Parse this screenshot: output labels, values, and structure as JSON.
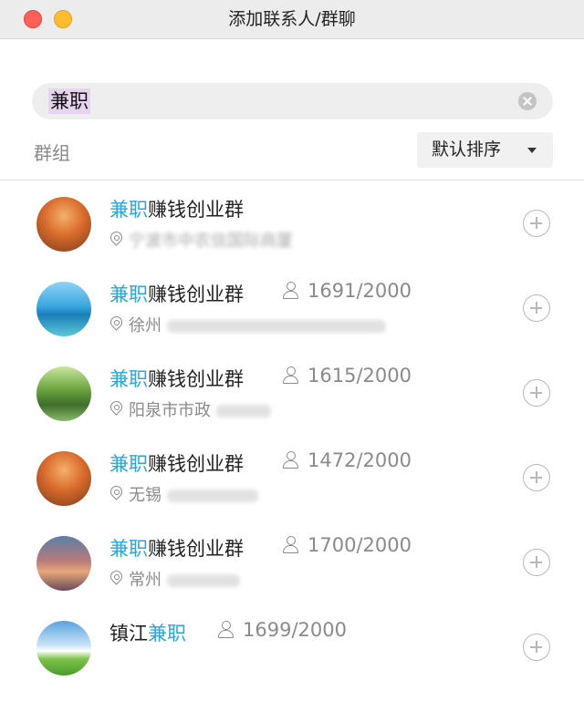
{
  "window": {
    "title": "添加联系人/群聊"
  },
  "search": {
    "query": "兼职"
  },
  "section": {
    "label": "群组"
  },
  "sort": {
    "label": "默认排序"
  },
  "groups": [
    {
      "highlight": "兼职",
      "rest": "赚钱创业群",
      "prefix": "",
      "members": "",
      "location": "宁波市中农信国际商厦",
      "avatar": "autumn-road"
    },
    {
      "highlight": "兼职",
      "rest": "赚钱创业群",
      "prefix": "",
      "members": "1691/2000",
      "location": "徐州",
      "avatar": "beach-pier"
    },
    {
      "highlight": "兼职",
      "rest": "赚钱创业群",
      "prefix": "",
      "members": "1615/2000",
      "location": "阳泉市市政",
      "avatar": "park-lake"
    },
    {
      "highlight": "兼职",
      "rest": "赚钱创业群",
      "prefix": "",
      "members": "1472/2000",
      "location": "无锡",
      "avatar": "autumn-road"
    },
    {
      "highlight": "兼职",
      "rest": "赚钱创业群",
      "prefix": "",
      "members": "1700/2000",
      "location": "常州",
      "avatar": "eiffel-tower"
    },
    {
      "highlight": "兼职",
      "rest": "",
      "prefix": "镇江",
      "members": "1699/2000",
      "location": "",
      "avatar": "sky-grass"
    }
  ],
  "colors": {
    "highlight": "#2aa7d7",
    "muted": "#8a8a8a",
    "close": "#fe5f57",
    "minimize": "#febc2e"
  }
}
